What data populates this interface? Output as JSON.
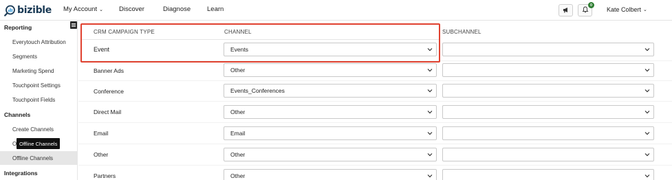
{
  "brand": {
    "name": "bizible"
  },
  "nav": {
    "items": [
      {
        "label": "My Account",
        "has_menu": true
      },
      {
        "label": "Discover",
        "has_menu": false
      },
      {
        "label": "Diagnose",
        "has_menu": false
      },
      {
        "label": "Learn",
        "has_menu": false
      }
    ]
  },
  "topbar": {
    "notifications_count": "0",
    "user_name": "Kate Colbert",
    "icons": [
      "megaphone-icon",
      "bell-icon"
    ]
  },
  "sidebar": {
    "sections": [
      {
        "title": "Reporting",
        "items": [
          "Everytouch Attribution",
          "Segments",
          "Marketing Spend",
          "Touchpoint Settings",
          "Touchpoint Fields"
        ]
      },
      {
        "title": "Channels",
        "items": [
          "Create Channels",
          "Online Channels",
          "Offline Channels"
        ]
      },
      {
        "title": "Integrations",
        "items": []
      }
    ],
    "active_item": "Offline Channels",
    "tooltip": "Offline Channels"
  },
  "table": {
    "headers": {
      "type": "CRM CAMPAIGN TYPE",
      "channel": "CHANNEL",
      "subchannel": "SUBCHANNEL"
    },
    "rows": [
      {
        "type": "Event",
        "channel": "Events",
        "subchannel": ""
      },
      {
        "type": "Banner Ads",
        "channel": "Other",
        "subchannel": ""
      },
      {
        "type": "Conference",
        "channel": "Events_Conferences",
        "subchannel": ""
      },
      {
        "type": "Direct Mail",
        "channel": "Other",
        "subchannel": ""
      },
      {
        "type": "Email",
        "channel": "Email",
        "subchannel": ""
      },
      {
        "type": "Other",
        "channel": "Other",
        "subchannel": ""
      },
      {
        "type": "Partners",
        "channel": "Other",
        "subchannel": ""
      }
    ]
  },
  "colors": {
    "highlight": "#e0412f",
    "brand": "#1a3a55",
    "badge": "#2e7d32"
  }
}
